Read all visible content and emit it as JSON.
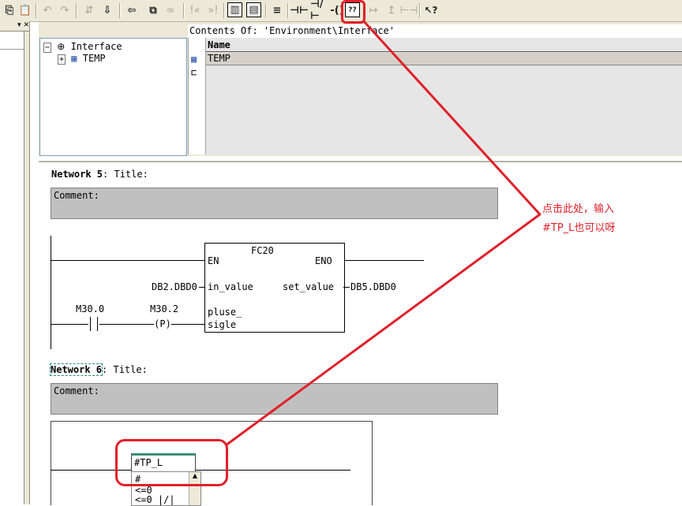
{
  "toolbar": {
    "help_icon_label": "??",
    "arrow_icon_label": "↖?"
  },
  "tree": {
    "root_label": "Interface",
    "child_label": "TEMP"
  },
  "contents": {
    "path_label": "Contents Of: 'Environment\\Interface'",
    "column_name": "Name",
    "rows": [
      "TEMP"
    ]
  },
  "network5": {
    "label": "Network 5",
    "title": ": Title:",
    "comment": "Comment:",
    "block_name": "FC20",
    "pin_en": "EN",
    "pin_eno": "ENO",
    "pin_in_value": "in_value",
    "pin_set_value": "set_value",
    "pin_pluse_line1": "pluse_",
    "pin_pluse_line2": "sigle",
    "in_operand": "DB2.DBD0",
    "out_operand": "DB5.DBD0",
    "contact1_address": "M30.0",
    "contact2_address": "M30.2",
    "contact2_symbol": "P"
  },
  "network6": {
    "label": "Network 6",
    "title": ": Title:",
    "comment": "Comment:",
    "edit_value": "#TP_L",
    "dropdown_items": [
      "#",
      "<=0",
      "<=0 |/|"
    ]
  },
  "annotation": {
    "line1": "点击此处，输入",
    "line2": "#TP_L也可以呀",
    "color": "#e0202a"
  }
}
